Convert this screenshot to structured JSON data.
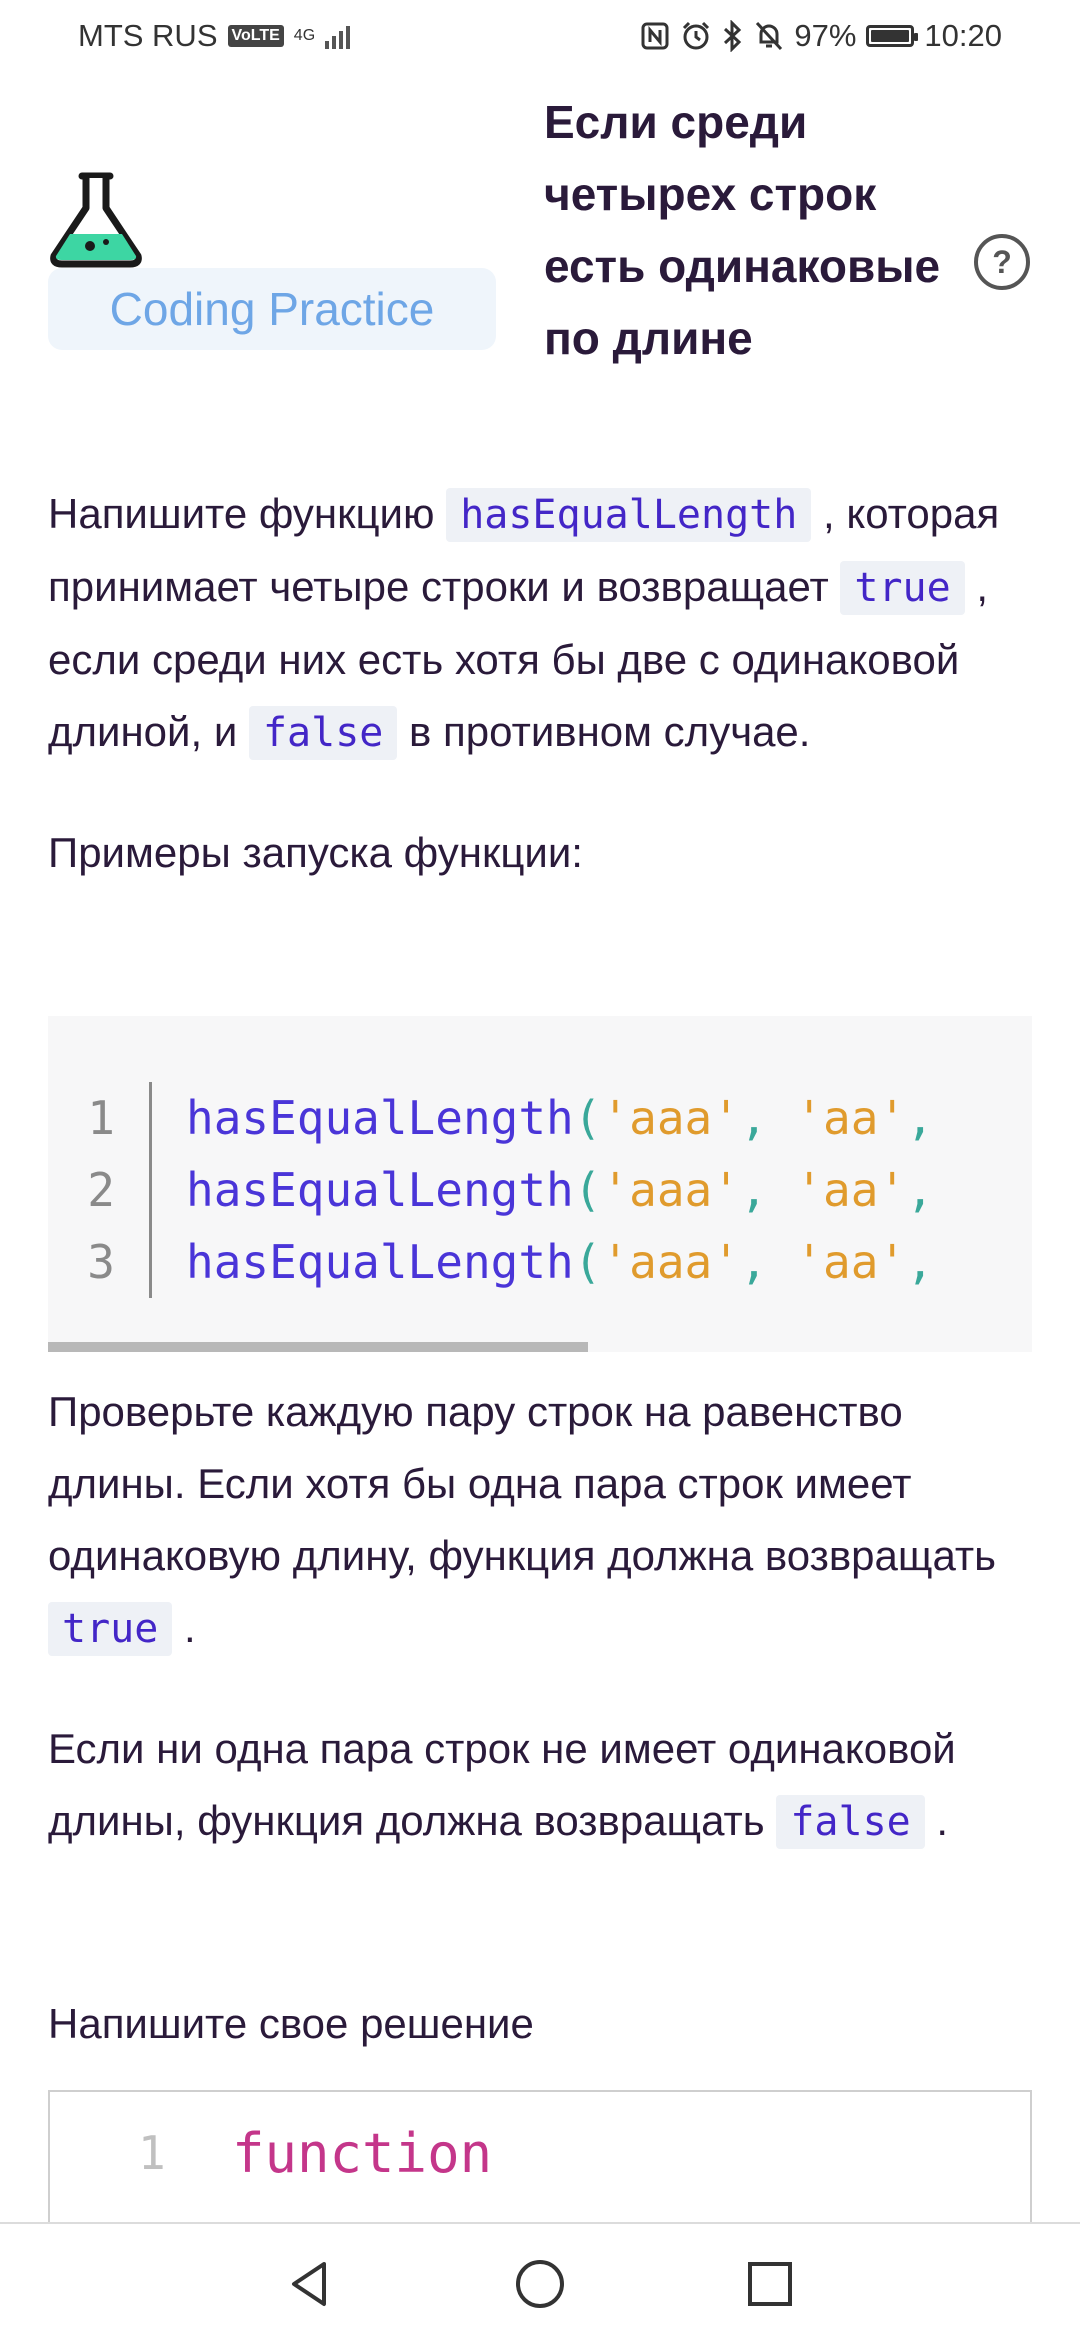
{
  "status_bar": {
    "carrier": "MTS RUS",
    "volte": "VoLTE",
    "network": "4G",
    "battery": "97%",
    "time": "10:20"
  },
  "header": {
    "badge": "Coding Practice",
    "title": "Если среди четырех строк есть одинаковые по длине"
  },
  "description": {
    "p1_a": "Напишите функцию ",
    "p1_code1": "hasEqualLength",
    "p1_b": " , которая принимает четыре строки и возвращает ",
    "p1_code2": "true",
    "p1_c": " , если среди них есть хотя бы две с одинаковой длиной, и ",
    "p1_code3": "false",
    "p1_d": " в противном случае.",
    "p2": "Примеры запуска функции:"
  },
  "example_code": {
    "lines": [
      {
        "num": "1",
        "fn": "hasEqualLength",
        "open": "(",
        "s1": "'aaa'",
        "c1": ", ",
        "s2": "'aa'",
        "c2": ","
      },
      {
        "num": "2",
        "fn": "hasEqualLength",
        "open": "(",
        "s1": "'aaa'",
        "c1": ", ",
        "s2": "'aa'",
        "c2": ","
      },
      {
        "num": "3",
        "fn": "hasEqualLength",
        "open": "(",
        "s1": "'aaa'",
        "c1": ", ",
        "s2": "'aa'",
        "c2": ","
      }
    ]
  },
  "explanation": {
    "p3_a": "Проверьте каждую пару строк на равенство длины. Если хотя бы одна пара строк имеет одинаковую длину, функция должна возвращать ",
    "p3_code": "true",
    "p3_b": " .",
    "p4_a": "Если ни одна пара строк не имеет одинаковой длины, функция должна возвращать ",
    "p4_code": "false",
    "p4_b": " ."
  },
  "solution": {
    "label": "Напишите свое решение",
    "line_num": "1",
    "code": "function"
  },
  "colors": {
    "accent": "#6ea6e6",
    "code_fn": "#4a35d8",
    "code_str": "#e09b2d",
    "keyword": "#c4368a"
  }
}
